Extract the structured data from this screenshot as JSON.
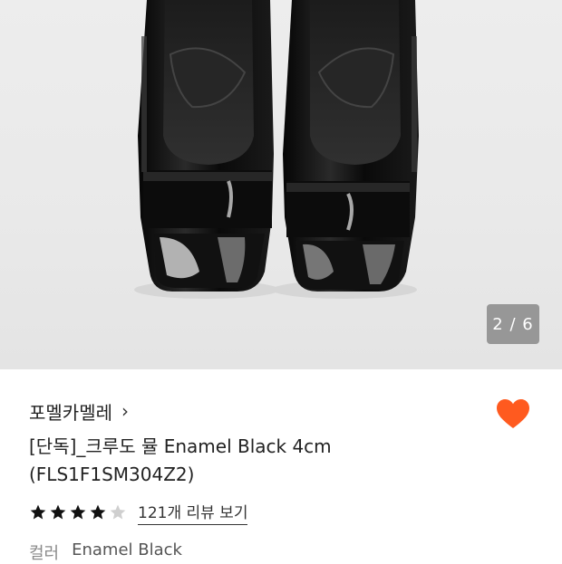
{
  "gallery": {
    "counter": "2 / 6",
    "image_icon": "black-enamel-open-toe-shoes-image"
  },
  "product": {
    "brand": "포멜카멜레",
    "brand_chevron": "›",
    "title_line1": "[단독]_크루도 뮬 Enamel Black 4cm",
    "title_line2": "(FLS1F1SM304Z2)",
    "rating": 4,
    "rating_max": 5,
    "review_link": "121개 리뷰 보기",
    "color_label": "컬러",
    "color_value": "Enamel Black",
    "liked": true
  },
  "colors": {
    "heart": "#ff5a1f",
    "star_filled": "#111111",
    "star_empty": "#cfcfcf"
  }
}
